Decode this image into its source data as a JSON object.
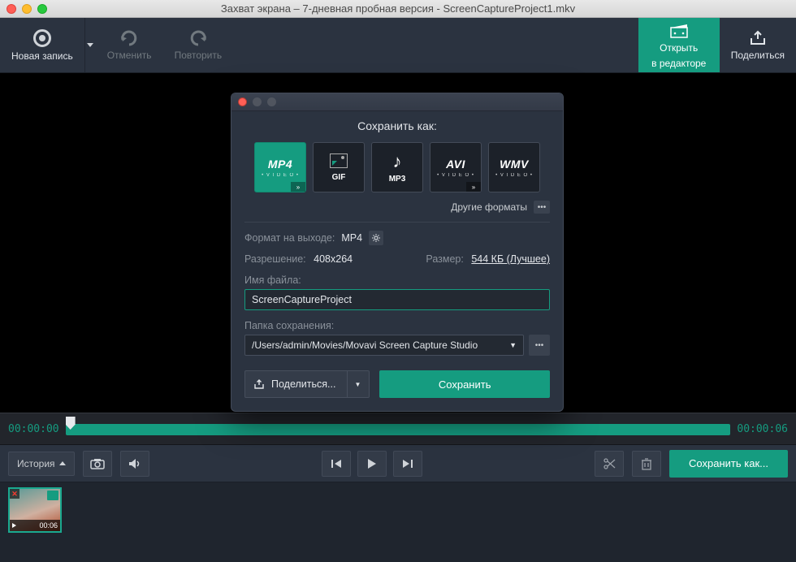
{
  "window": {
    "title": "Захват экрана – 7-дневная пробная версия - ScreenCaptureProject1.mkv"
  },
  "toolbar": {
    "new_record": "Новая запись",
    "undo": "Отменить",
    "redo": "Повторить",
    "open_editor_l1": "Открыть",
    "open_editor_l2": "в редакторе",
    "share": "Поделиться"
  },
  "timeline": {
    "start": "00:00:00",
    "end": "00:00:06"
  },
  "controls": {
    "history": "История",
    "save_as": "Сохранить как..."
  },
  "thumbnail": {
    "duration": "00:06"
  },
  "dialog": {
    "title": "Сохранить как:",
    "formats": [
      "MP4",
      "GIF",
      "MP3",
      "AVI",
      "WMV"
    ],
    "selected_format_index": 0,
    "other_formats": "Другие форматы",
    "output_format_label": "Формат на выходе:",
    "output_format_value": "MP4",
    "resolution_label": "Разрешение:",
    "resolution_value": "408x264",
    "size_label": "Размер:",
    "size_value": "544 КБ (Лучшее)",
    "filename_label": "Имя файла:",
    "filename_value": "ScreenCaptureProject",
    "folder_label": "Папка сохранения:",
    "folder_value": "/Users/admin/Movies/Movavi Screen Capture Studio",
    "share_btn": "Поделиться...",
    "save_btn": "Сохранить"
  }
}
